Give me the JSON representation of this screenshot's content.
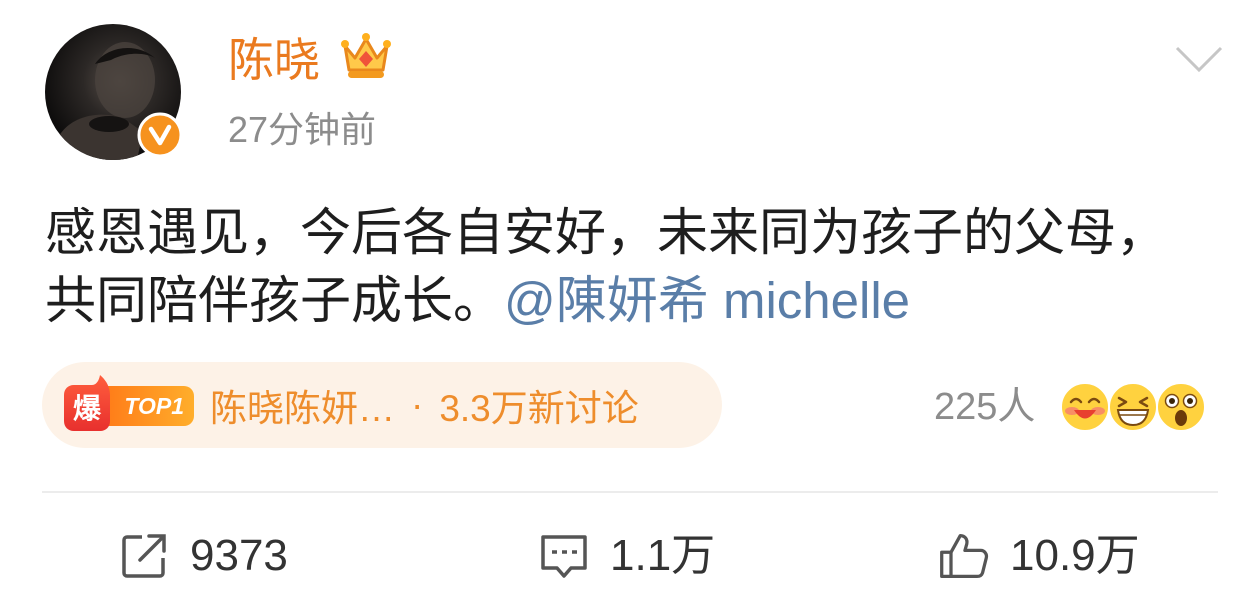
{
  "post": {
    "author": {
      "name": "陈晓",
      "avatar": "avatar-photo",
      "verified_icon": "verified-badge-icon",
      "vip_icon": "crown-icon"
    },
    "timestamp": "27分钟前",
    "text": "感恩遇见，今后各自安好，未来同为孩子的父母，共同陪伴孩子成长。",
    "mention": "@陳妍希 michelle",
    "more_icon": "chevron-down-icon"
  },
  "hot_topic": {
    "badge": "爆",
    "rank": "TOP1",
    "title": "陈晓陈妍…",
    "separator": "·",
    "discussion": "3.3万新讨论"
  },
  "reactions": {
    "count": "225人",
    "emojis": [
      "drool-emoji",
      "laugh-emoji",
      "shocked-emoji"
    ]
  },
  "actions": {
    "repost": {
      "icon": "share-icon",
      "count": "9373"
    },
    "comment": {
      "icon": "comment-icon",
      "count": "1.1万"
    },
    "like": {
      "icon": "thumbs-up-icon",
      "count": "10.9万"
    }
  },
  "colors": {
    "name": "#ea7a1f",
    "mention": "#5a7ea8",
    "hot_topic_text": "#ee8d2c",
    "hot_topic_bg": "#fdf2e7",
    "verified": "#f6921e",
    "muted_text": "#8c8c8c",
    "count_text": "#333333"
  }
}
